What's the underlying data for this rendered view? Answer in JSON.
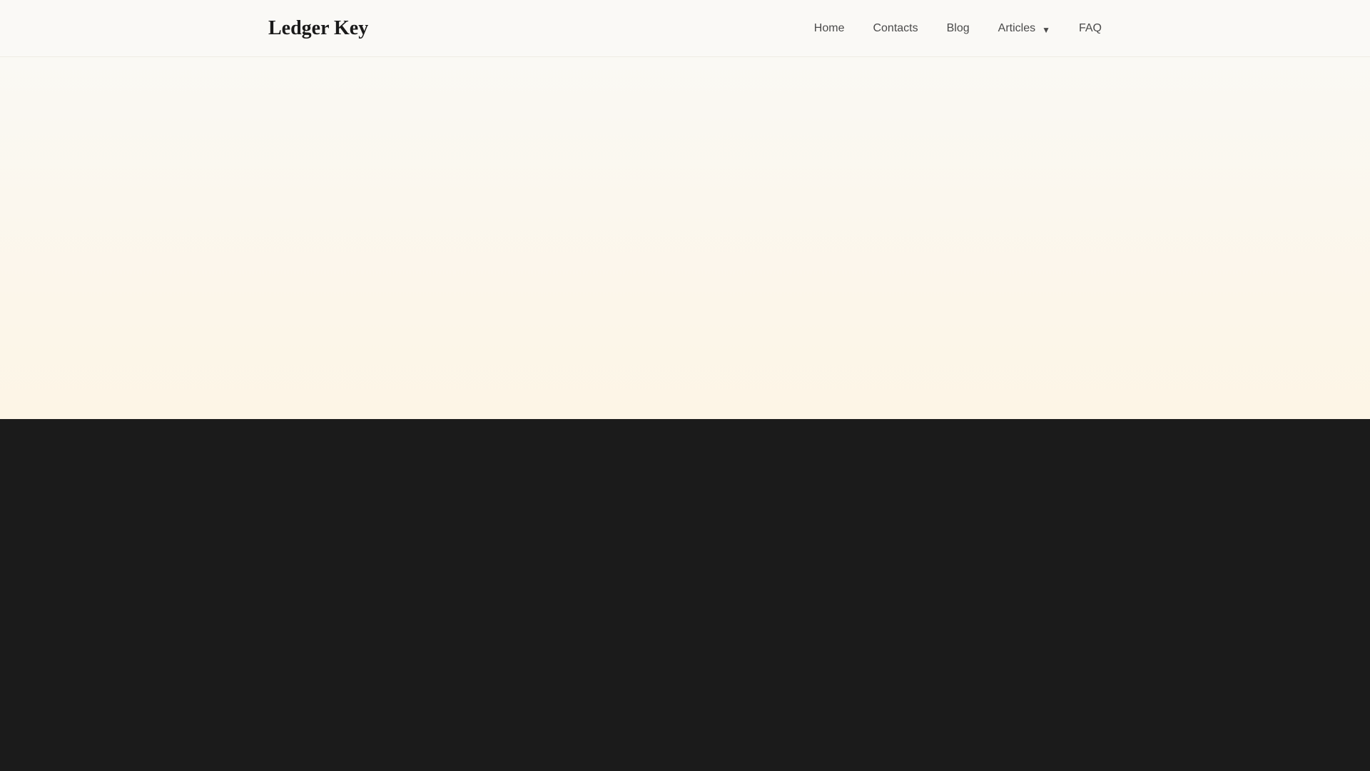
{
  "header": {
    "logo": "Ledger Key",
    "nav": [
      {
        "label": "Home"
      },
      {
        "label": "Contacts"
      },
      {
        "label": "Blog"
      },
      {
        "label": "Articles",
        "has_dropdown": true,
        "caret": "▼"
      },
      {
        "label": "FAQ"
      }
    ]
  },
  "colors": {
    "header_bg": "#faf9f6",
    "hero_top": "#faf9f4",
    "hero_bottom": "#fdf5e6",
    "dark_section": "#1b1b1b",
    "text_primary": "#1a1a1a",
    "text_nav": "#4a4a4a"
  },
  "icons": {
    "articles_dropdown": "chevron-down-icon"
  }
}
